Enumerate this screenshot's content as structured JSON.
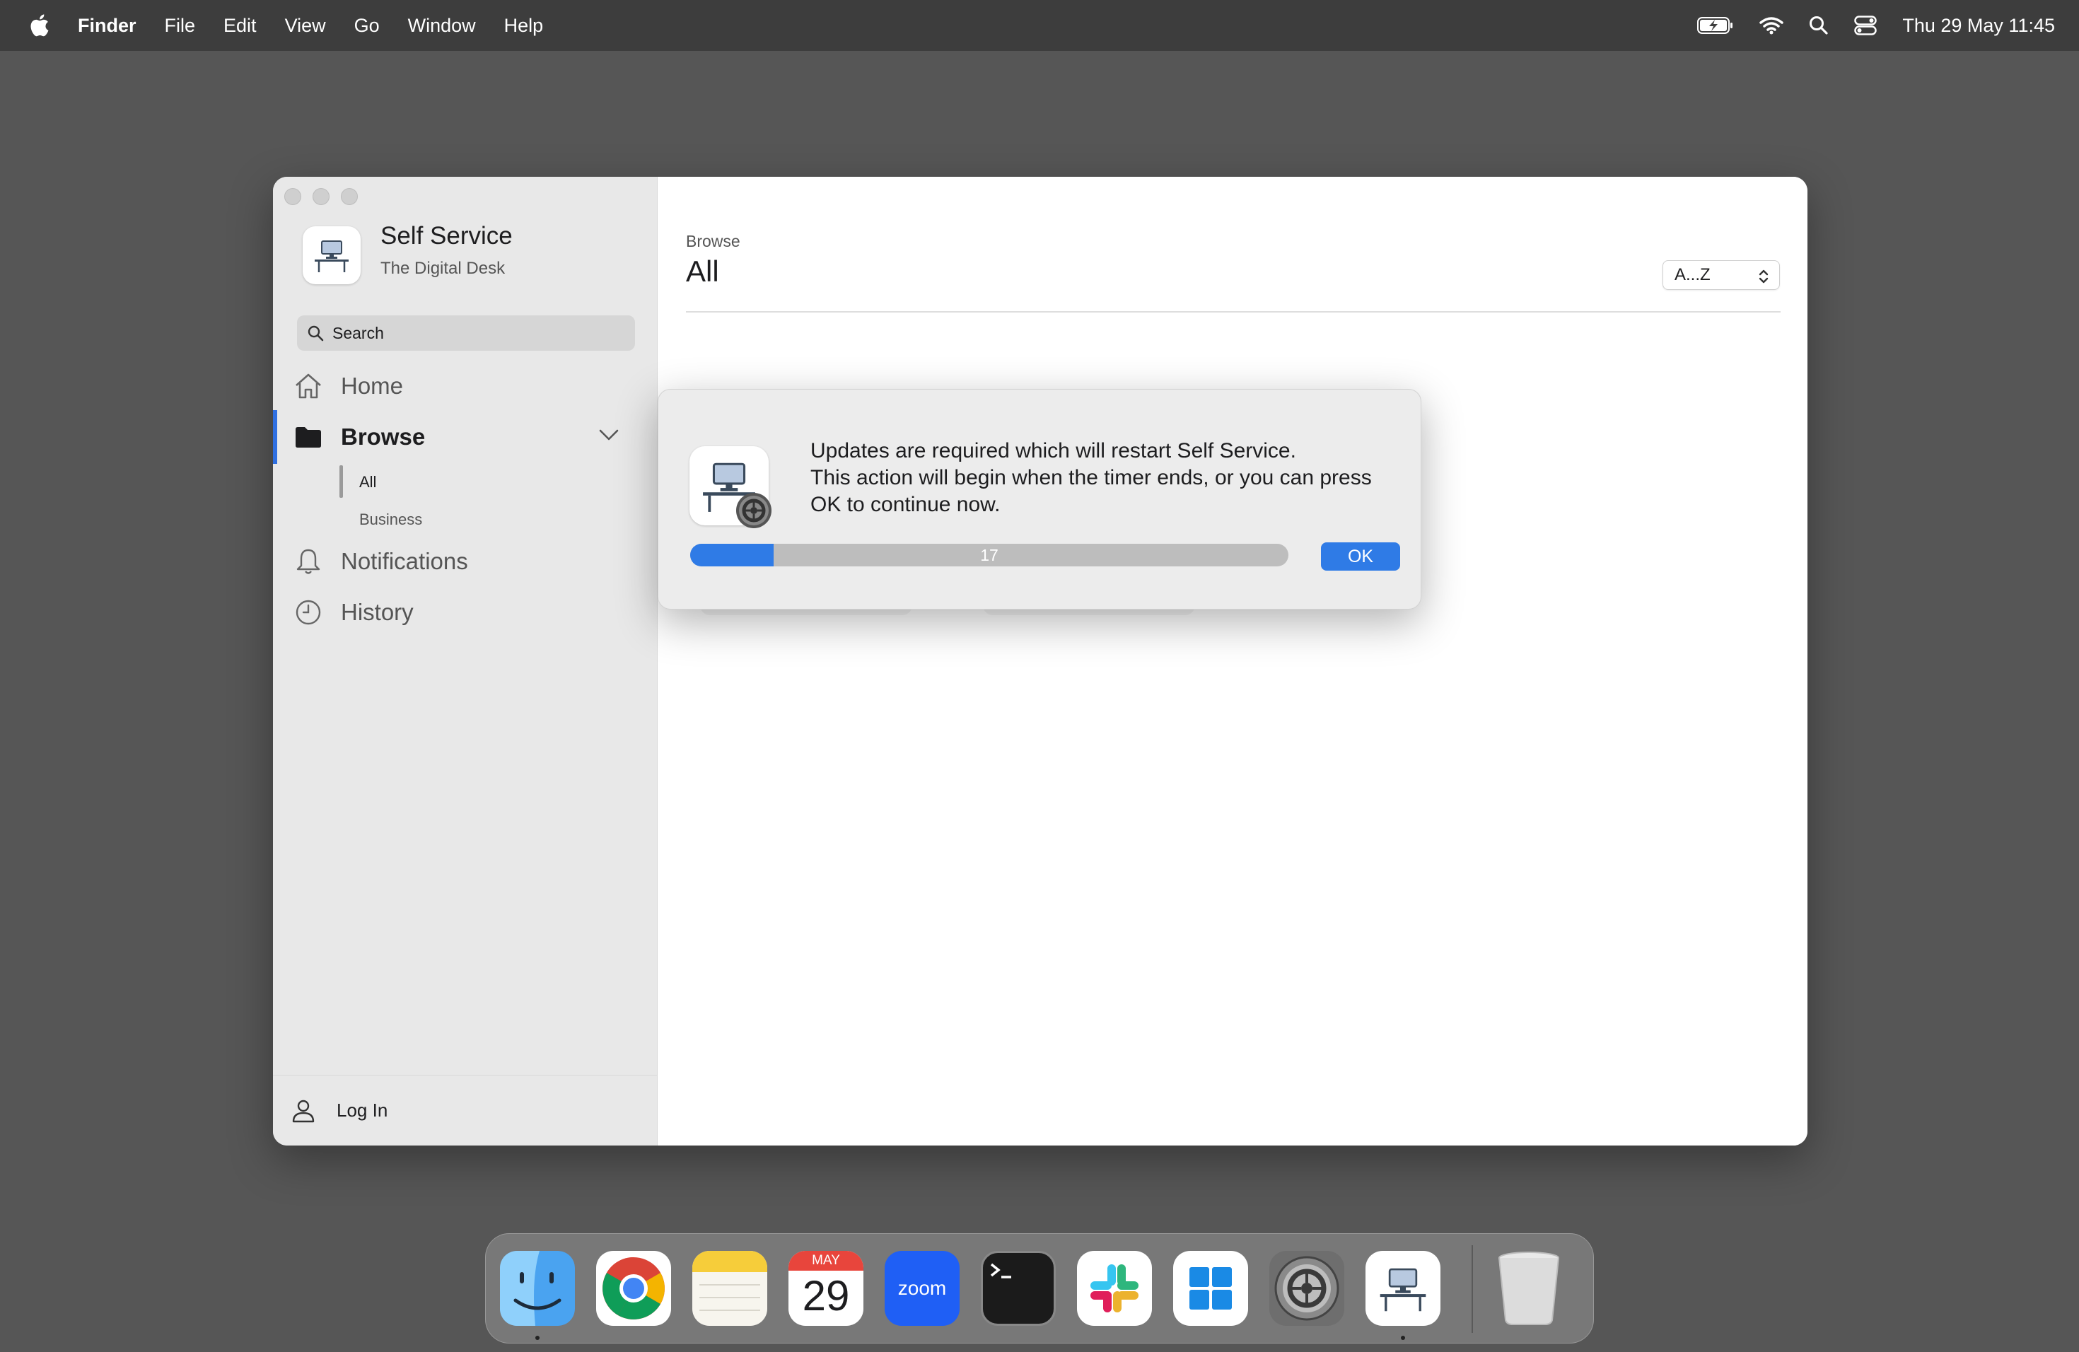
{
  "menubar": {
    "items": [
      "Finder",
      "File",
      "Edit",
      "View",
      "Go",
      "Window",
      "Help"
    ],
    "clock": "Thu 29 May  11:45",
    "status_icons": [
      "battery-charging-icon",
      "wifi-icon",
      "spotlight-search-icon",
      "control-center-icon"
    ]
  },
  "app": {
    "name": "Self Service",
    "org": "The Digital Desk"
  },
  "sidebar": {
    "search_placeholder": "Search",
    "nav": {
      "home": "Home",
      "browse": "Browse",
      "notifications": "Notifications",
      "history": "History"
    },
    "browse_sub": [
      "All",
      "Business"
    ],
    "footer_login": "Log In"
  },
  "main": {
    "breadcrumb": "Browse",
    "title": "All",
    "sort_value": "A...Z"
  },
  "dialog": {
    "line1": "Updates are required which will restart Self Service.",
    "line2": "This action will begin when the timer ends, or you can press",
    "line3": "OK to continue now.",
    "countdown": "17",
    "progress_fraction": 0.14,
    "ok_label": "OK"
  },
  "dock": {
    "apps": [
      "Finder",
      "Google Chrome",
      "Notes",
      "Calendar",
      "Zoom",
      "Terminal",
      "Slack",
      "Windows App",
      "System Settings",
      "Self Service",
      "Trash"
    ],
    "calendar_month": "MAY",
    "calendar_day": "29",
    "zoom_label": "zoom"
  },
  "colors": {
    "accent": "#2f7be6",
    "menubar": "#3d3d3d",
    "desktop": "#565656"
  }
}
